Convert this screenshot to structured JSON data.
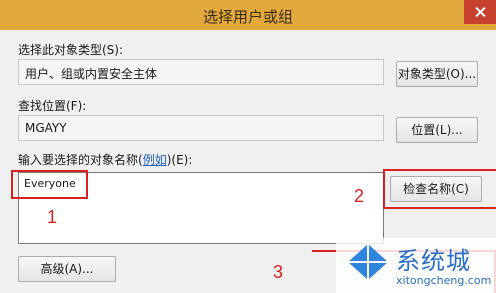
{
  "window": {
    "title": "选择用户或组"
  },
  "object_type": {
    "label": "选择此对象类型(S):",
    "value": "用户、组或内置安全主体",
    "button_label": "对象类型(O)..."
  },
  "location": {
    "label": "查找位置(F):",
    "value": "MGAYY",
    "button_label": "位置(L)..."
  },
  "names": {
    "label_prefix": "输入要选择的对象名称(",
    "label_link": "例如",
    "label_suffix": ")(E):",
    "value": "Everyone",
    "check_button_label": "检查名称(C)"
  },
  "advanced_button_label": "高级(A)...",
  "annotations": {
    "marker_1": "1",
    "marker_2": "2",
    "marker_3": "3",
    "color": "#d92020"
  },
  "watermark": {
    "title": "系统城",
    "url": "xitongcheng.com",
    "icon": "windows-logo-icon"
  },
  "colors": {
    "titlebar": "#e2a93d",
    "close_button": "#c8402e",
    "link": "#1f5fbf",
    "watermark": "#2a6fc4"
  }
}
